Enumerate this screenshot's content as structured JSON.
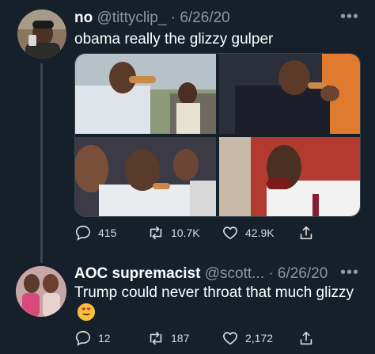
{
  "tweet1": {
    "name": "no",
    "handle": "@tittyclip_",
    "separator": " · ",
    "date": "6/26/20",
    "text": "obama really the glizzy gulper",
    "stats": {
      "replies": "415",
      "retweets": "10.7K",
      "likes": "42.9K"
    }
  },
  "tweet2": {
    "name": "AOC supremacist",
    "handle": "@scott...",
    "separator": " · ",
    "date": "6/26/20",
    "text": "Trump could never throat that much glizzy",
    "stats": {
      "replies": "12",
      "retweets": "187",
      "likes": "2,172"
    }
  },
  "more_glyph": "•••",
  "colors": {
    "background": "#15202b",
    "muted": "#8899a6",
    "line": "#38444d"
  }
}
